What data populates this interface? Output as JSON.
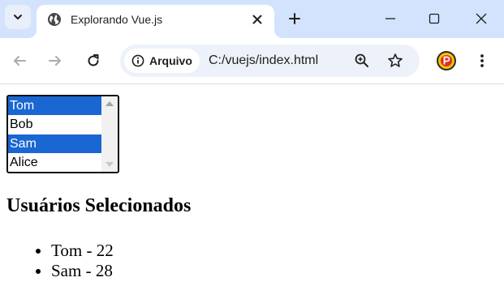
{
  "tab": {
    "title": "Explorando Vue.js",
    "favicon": "globe-icon"
  },
  "toolbar": {
    "site_chip_label": "Arquivo",
    "url": "C:/vuejs/index.html"
  },
  "colors": {
    "tabstrip_bg": "#d3e3fd",
    "omnibox_bg": "#edf2fa",
    "selection": "#1a66d2"
  },
  "listbox": {
    "options": [
      {
        "label": "Tom",
        "selected": true
      },
      {
        "label": "Bob",
        "selected": false
      },
      {
        "label": "Sam",
        "selected": true
      },
      {
        "label": "Alice",
        "selected": false
      }
    ]
  },
  "selected_users": {
    "heading": "Usuários Selecionados",
    "items": [
      {
        "text": "Tom - 22"
      },
      {
        "text": "Sam - 28"
      }
    ]
  }
}
